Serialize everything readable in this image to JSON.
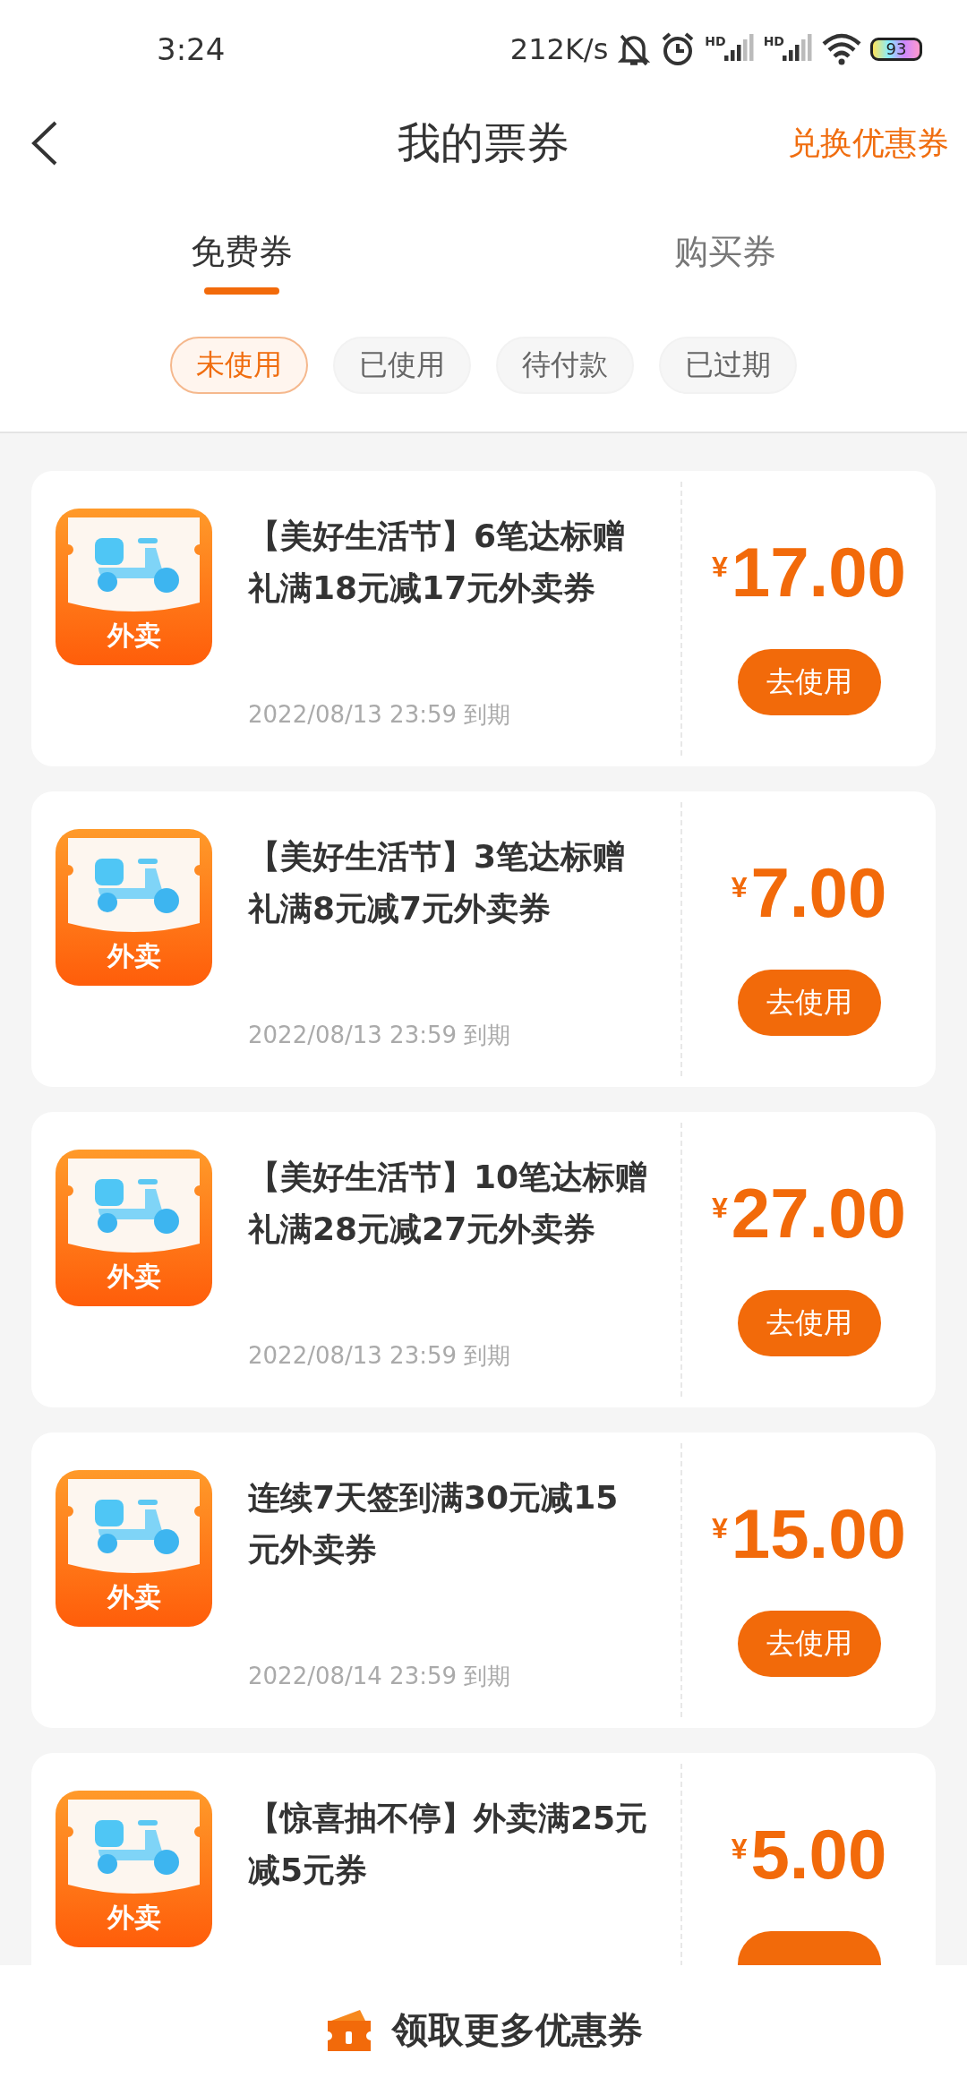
{
  "status_bar": {
    "time": "3:24",
    "speed": "212K/s",
    "signal_labels": [
      "HD",
      "HD"
    ],
    "battery": "93"
  },
  "header": {
    "title": "我的票券",
    "action": "兑换优惠券"
  },
  "tabs": [
    {
      "label": "免费券",
      "selected": true
    },
    {
      "label": "购买券",
      "selected": false
    }
  ],
  "filters": [
    {
      "label": "未使用",
      "selected": true
    },
    {
      "label": "已使用",
      "selected": false
    },
    {
      "label": "待付款",
      "selected": false
    },
    {
      "label": "已过期",
      "selected": false
    }
  ],
  "coupons": [
    {
      "icon_label": "外卖",
      "title": "【美好生活节】6笔达标赠礼满18元减17元外卖券",
      "expiry": "2022/08/13 23:59 到期",
      "currency": "¥",
      "amount": "17.00",
      "button": "去使用"
    },
    {
      "icon_label": "外卖",
      "title": "【美好生活节】3笔达标赠礼满8元减7元外卖券",
      "expiry": "2022/08/13 23:59 到期",
      "currency": "¥",
      "amount": "7.00",
      "button": "去使用"
    },
    {
      "icon_label": "外卖",
      "title": "【美好生活节】10笔达标赠礼满28元减27元外卖券",
      "expiry": "2022/08/13 23:59 到期",
      "currency": "¥",
      "amount": "27.00",
      "button": "去使用"
    },
    {
      "icon_label": "外卖",
      "title": "连续7天签到满30元减15元外卖券",
      "expiry": "2022/08/14 23:59 到期",
      "currency": "¥",
      "amount": "15.00",
      "button": "去使用"
    },
    {
      "icon_label": "外卖",
      "title": "【惊喜抽不停】外卖满25元减5元券",
      "currency": "¥",
      "amount": "5.00"
    }
  ],
  "footer": {
    "label": "领取更多优惠券"
  }
}
